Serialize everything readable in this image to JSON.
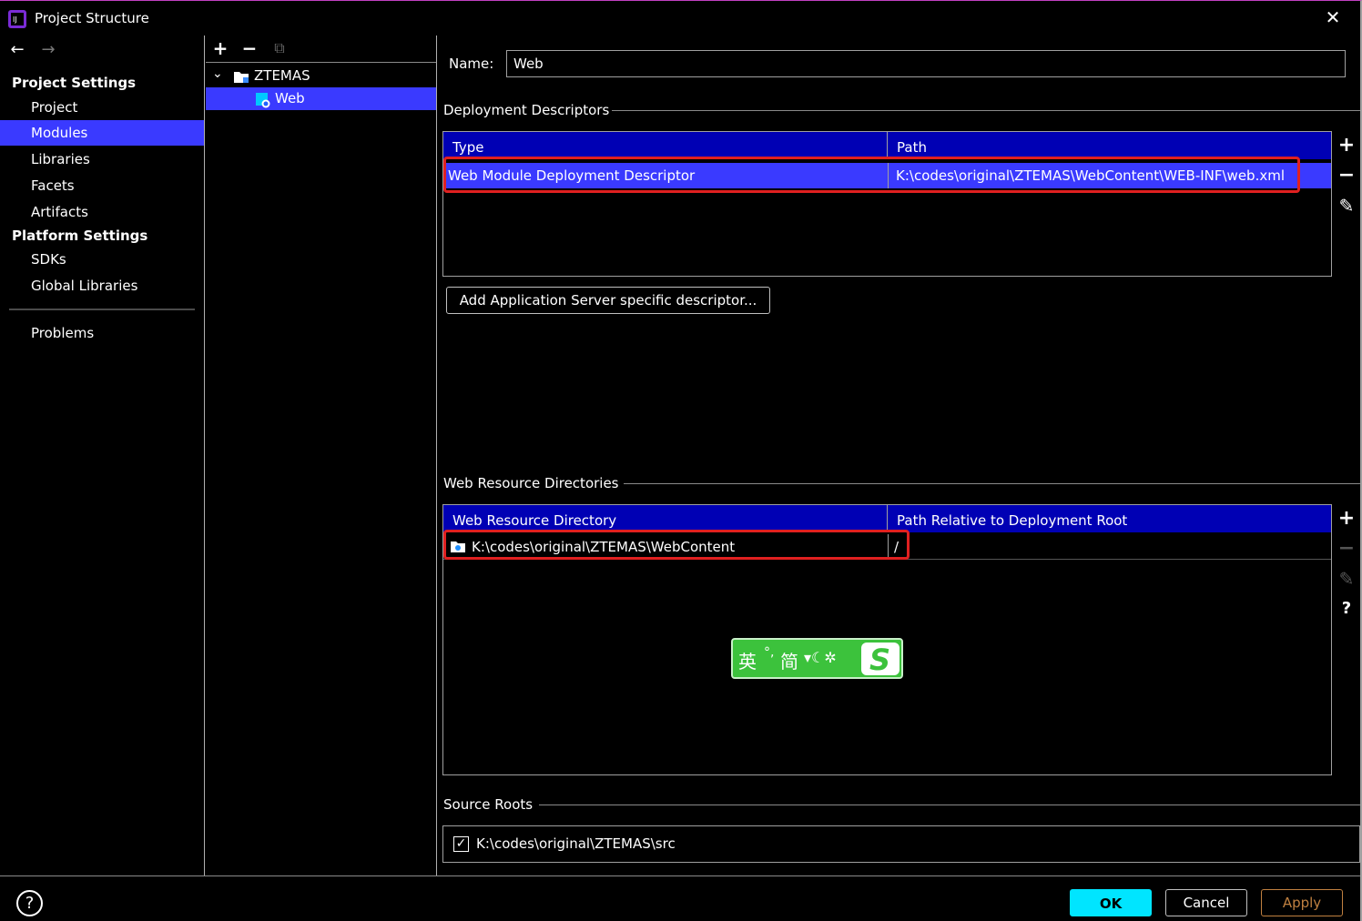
{
  "window": {
    "title": "Project Structure",
    "close_glyph": "✕"
  },
  "nav": {
    "back_glyph": "←",
    "forward_glyph": "→",
    "project_settings_header": "Project Settings",
    "platform_settings_header": "Platform Settings",
    "items": [
      {
        "label": "Project"
      },
      {
        "label": "Modules",
        "selected": true
      },
      {
        "label": "Libraries"
      },
      {
        "label": "Facets"
      },
      {
        "label": "Artifacts"
      },
      {
        "label": "SDKs"
      },
      {
        "label": "Global Libraries"
      },
      {
        "label": "Problems"
      }
    ]
  },
  "tree": {
    "add_glyph": "+",
    "remove_glyph": "−",
    "copy_glyph": "⧉",
    "expand_glyph": "⌄",
    "root_label": "ZTEMAS",
    "child_label": "Web"
  },
  "main": {
    "name_label": "Name:",
    "name_value": "Web",
    "deployment_descriptors": {
      "title": "Deployment Descriptors",
      "col_type": "Type",
      "col_path": "Path",
      "rows": [
        {
          "type": "Web Module Deployment Descriptor",
          "path": "K:\\codes\\original\\ZTEMAS\\WebContent\\WEB-INF\\web.xml"
        }
      ],
      "add_server_btn": "Add Application Server specific descriptor..."
    },
    "web_resource_directories": {
      "title": "Web Resource Directories",
      "col_dir": "Web Resource Directory",
      "col_rel": "Path Relative to Deployment Root",
      "rows": [
        {
          "dir": "K:\\codes\\original\\ZTEMAS\\WebContent",
          "rel": "/"
        }
      ]
    },
    "source_roots": {
      "title": "Source Roots",
      "rows": [
        {
          "path": "K:\\codes\\original\\ZTEMAS\\src",
          "checked": true
        }
      ]
    }
  },
  "side_tools": {
    "add": "+",
    "remove": "−",
    "edit": "✎",
    "help": "?"
  },
  "ime": {
    "text": "英",
    "mode": "简"
  },
  "footer": {
    "help_glyph": "?",
    "ok_label": "OK",
    "cancel_label": "Cancel",
    "apply_label": "Apply"
  },
  "colors": {
    "selection": "#3a3aff",
    "table_header": "#0000b4",
    "ok_button": "#00e5ff",
    "apply_border": "#c08040",
    "highlight_box": "#e02020"
  }
}
